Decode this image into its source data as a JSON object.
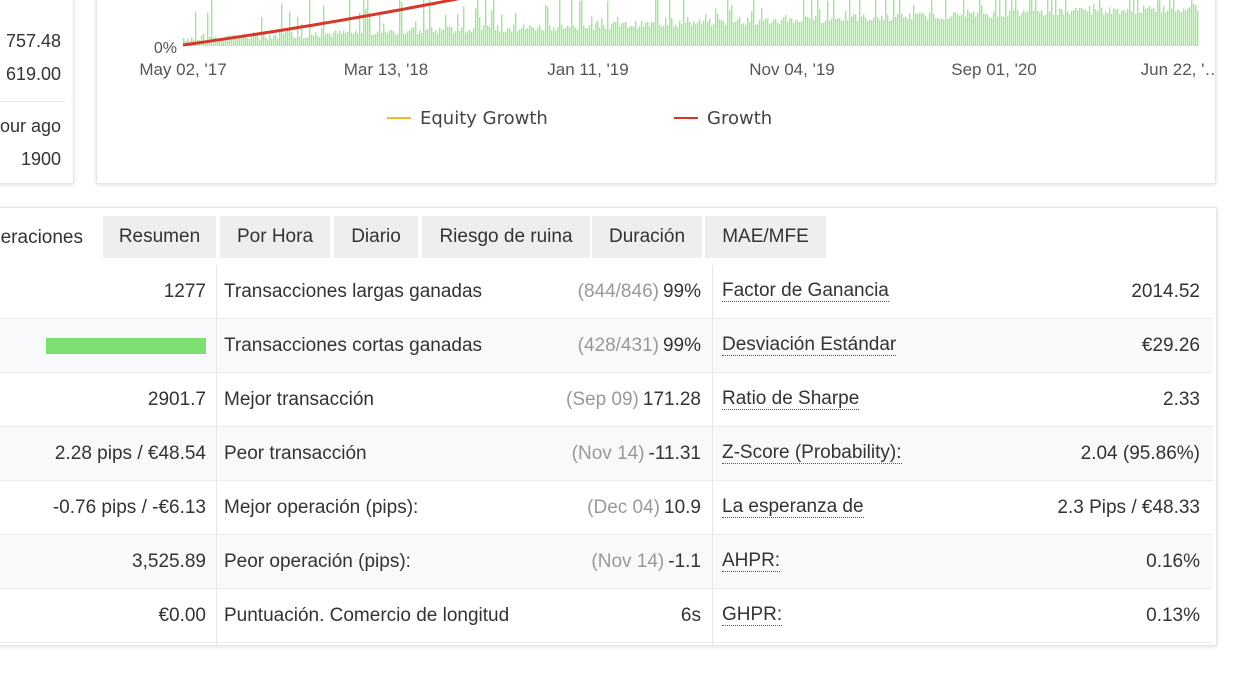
{
  "left_card": {
    "values": [
      "757.48",
      "619.00",
      "our ago",
      "1900"
    ]
  },
  "chart": {
    "y_axis_label": "0%",
    "x_ticks": [
      "May 02, '17",
      "Mar 13, '18",
      "Jan 11, '19",
      "Nov 04, '19",
      "Sep 01, '20",
      "Jun 22, '…"
    ],
    "legend": [
      {
        "name": "Equity Growth",
        "color": "#f5b62a"
      },
      {
        "name": "Growth",
        "color": "#d9362b"
      }
    ],
    "colors": {
      "bars": "#7ddf6f",
      "growth_line": "#d9362b"
    }
  },
  "chart_data": {
    "type": "line",
    "x": [
      "May 02, '17",
      "Mar 13, '18",
      "Jan 11, '19",
      "Nov 04, '19",
      "Sep 01, '20",
      "Jun 22, '…"
    ],
    "series": [
      {
        "name": "Equity Growth",
        "values": []
      },
      {
        "name": "Growth",
        "values": []
      }
    ],
    "grid": false,
    "legend_position": "bottom"
  },
  "tabs": [
    {
      "label": "eraciones",
      "active": true
    },
    {
      "label": "Resumen",
      "active": false
    },
    {
      "label": "Por Hora",
      "active": false
    },
    {
      "label": "Diario",
      "active": false
    },
    {
      "label": "Riesgo de ruina",
      "active": false
    },
    {
      "label": "Duración",
      "active": false
    },
    {
      "label": "MAE/MFE",
      "active": false
    }
  ],
  "rows": [
    {
      "col1": "1277",
      "col2": "Transacciones largas ganadas",
      "col3_muted": "(844/846)",
      "col3": "99%",
      "col4": "Factor de Ganancia",
      "col5": "2014.52"
    },
    {
      "col1": "",
      "col1_bar": 1.0,
      "col2": "Transacciones cortas ganadas",
      "col3_muted": "(428/431)",
      "col3": "99%",
      "col4": "Desviación Estándar",
      "col5": "€29.26"
    },
    {
      "col1": "2901.7",
      "col2": "Mejor transacción",
      "col3_muted": "(Sep 09)",
      "col3": "171.28",
      "col4": "Ratio de Sharpe",
      "col5": "2.33"
    },
    {
      "col1": "2.28 pips / €48.54",
      "col2": "Peor transacción",
      "col3_muted": "(Nov 14)",
      "col3": "-11.31",
      "col4": "Z-Score (Probability):",
      "col5": "2.04 (95.86%)"
    },
    {
      "col1": "-0.76 pips / -€6.13",
      "col2": "Mejor operación (pips):",
      "col3_muted": "(Dec 04)",
      "col3": "10.9",
      "col4": "La esperanza de",
      "col5": "2.3 Pips / €48.33"
    },
    {
      "col1": "3,525.89",
      "col2": "Peor operación (pips):",
      "col3_muted": "(Nov 14)",
      "col3": "-1.1",
      "col4": "AHPR:",
      "col5": "0.16%"
    },
    {
      "col1": "€0.00",
      "col2": "Puntuación. Comercio de longitud",
      "col3_muted": "",
      "col3": "6s",
      "col4": "GHPR:",
      "col5": "0.13%"
    }
  ]
}
